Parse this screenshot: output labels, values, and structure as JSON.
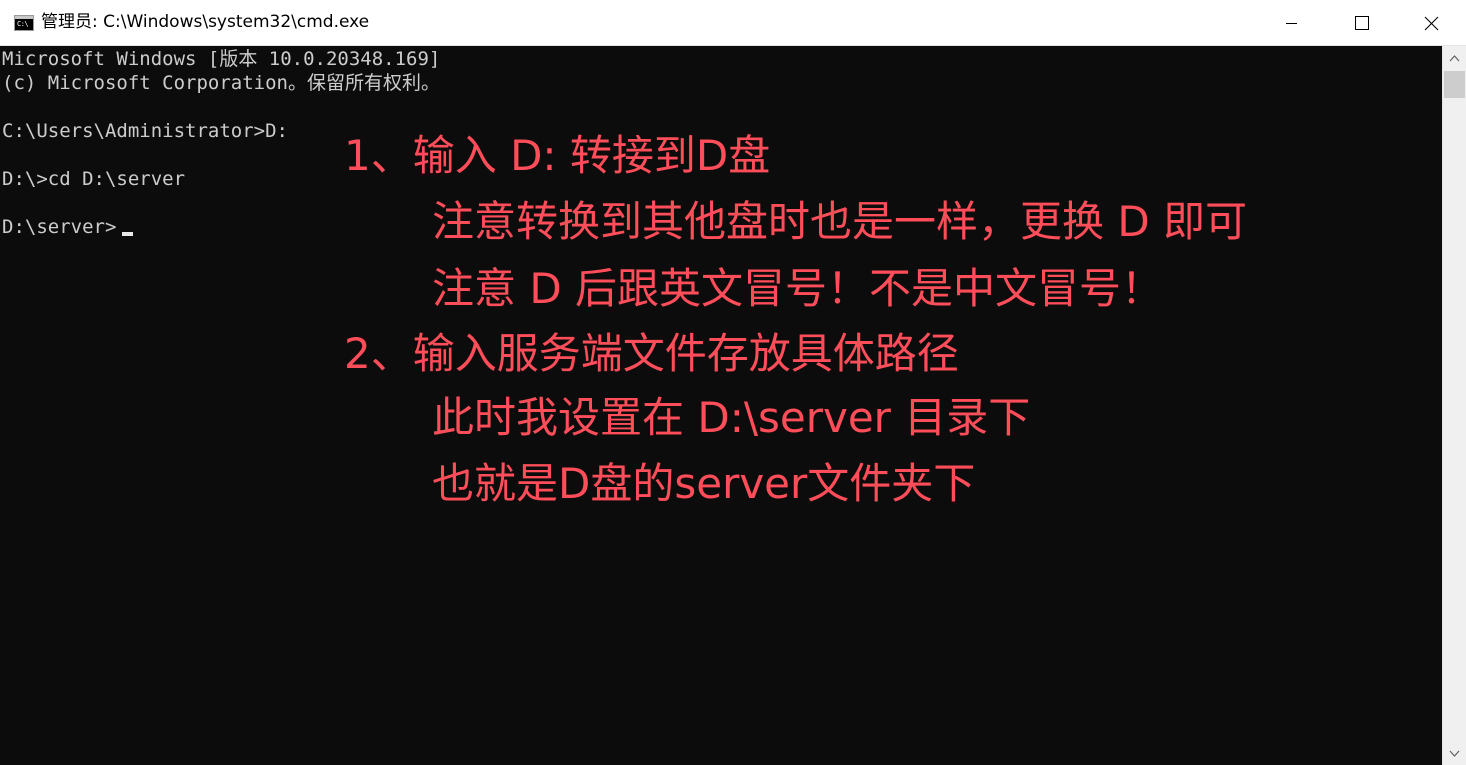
{
  "window": {
    "title": "管理员: C:\\Windows\\system32\\cmd.exe",
    "app_icon_glyph": "C:\\",
    "minimize_label": "minimize",
    "maximize_label": "maximize",
    "close_label": "close"
  },
  "console": {
    "lines": [
      "Microsoft Windows [版本 10.0.20348.169]",
      "(c) Microsoft Corporation。保留所有权利。",
      "C:\\Users\\Administrator>D:",
      "D:\\>cd D:\\server",
      "D:\\server>"
    ],
    "text_color": "#cccccc",
    "background_color": "#0c0c0c"
  },
  "annotations": {
    "color": "#ff4d5a",
    "lines": [
      "1、输入 D: 转接到D盘",
      "注意转换到其他盘时也是一样，更换 D 即可",
      "注意 D 后跟英文冒号！不是中文冒号！",
      "2、输入服务端文件存放具体路径",
      "此时我设置在 D:\\server 目录下",
      "也就是D盘的server文件夹下"
    ]
  }
}
